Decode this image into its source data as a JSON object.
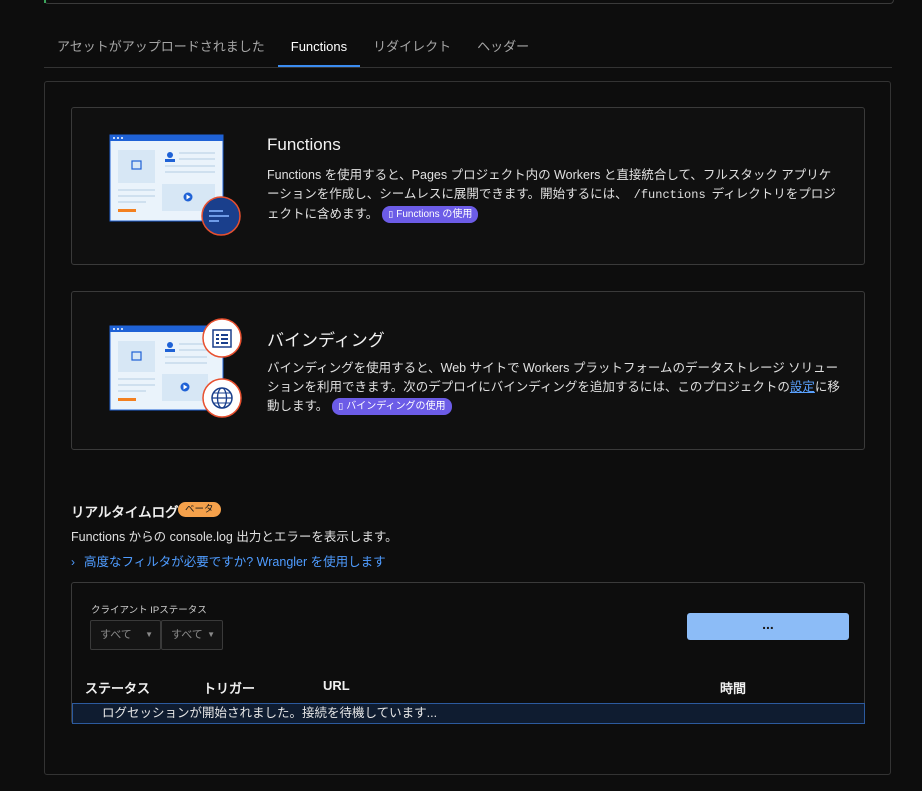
{
  "tabs": [
    {
      "label": "アセットがアップロードされました"
    },
    {
      "label": "Functions"
    },
    {
      "label": "リダイレクト"
    },
    {
      "label": "ヘッダー"
    }
  ],
  "functions_card": {
    "title": "Functions",
    "body_1": "Functions を使用すると、Pages プロジェクト内の Workers と直接統合して、フルスタック アプリケーションを作成し、シームレスに展開できます。開始するには、",
    "code": "/functions",
    "body_2": "ディレクトリをプロジェクトに含めます。",
    "badge": "Functions の使用"
  },
  "bindings_card": {
    "title": "バインディング",
    "body_1": "バインディングを使用すると、Web サイトで Workers プラットフォームのデータストレージ ソリューションを利用できます。次のデプロイにバインディングを追加するには、このプロジェクトの",
    "link": "設定",
    "body_2": "に移動します。",
    "badge": "バインディングの使用"
  },
  "realtime": {
    "title": "リアルタイムログ",
    "beta": "ベータ",
    "description": "Functions からの console.log 出力とエラーを表示します。",
    "advanced_link": "高度なフィルタが必要ですか? Wrangler を使用します",
    "filter_label": "クライアント IPステータス",
    "filter_client_ip": "すべて",
    "filter_status": "すべて",
    "action_button": "...",
    "columns": [
      "ステータス",
      "トリガー",
      "URL",
      "時間"
    ],
    "waiting_message": "ログセッションが開始されました。接続を待機しています..."
  },
  "colors": {
    "accent": "#3b8cf0",
    "badge": "#6c5ce7",
    "beta": "#f5a14b",
    "primary_button": "#8cbcf7"
  }
}
